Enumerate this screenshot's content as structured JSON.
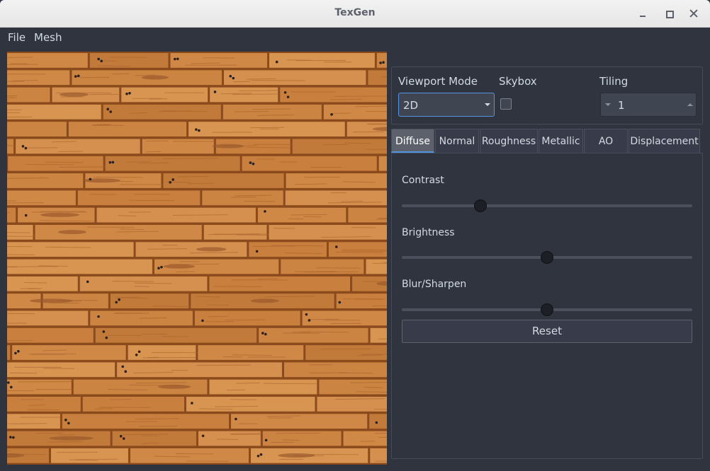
{
  "window": {
    "title": "TexGen"
  },
  "menu": {
    "items": [
      "File",
      "Mesh"
    ]
  },
  "settings": {
    "viewport_mode_label": "Viewport Mode",
    "viewport_mode_value": "2D",
    "skybox_label": "Skybox",
    "skybox_checked": false,
    "tiling_label": "Tiling",
    "tiling_value": "1"
  },
  "tabs": [
    "Diffuse",
    "Normal",
    "Roughness",
    "Metallic",
    "AO",
    "Displacement"
  ],
  "active_tab": "Diffuse",
  "diffuse": {
    "sliders": [
      {
        "label": "Contrast",
        "value": 0.27
      },
      {
        "label": "Brightness",
        "value": 0.5
      },
      {
        "label": "Blur/Sharpen",
        "value": 0.5
      }
    ],
    "reset_label": "Reset"
  },
  "colors": {
    "accent": "#5294e2",
    "background": "#2f343f",
    "wood_light": "#d08a48",
    "wood_dark": "#8a4a1c"
  },
  "viewport": {
    "content": "wood-planks-texture"
  }
}
